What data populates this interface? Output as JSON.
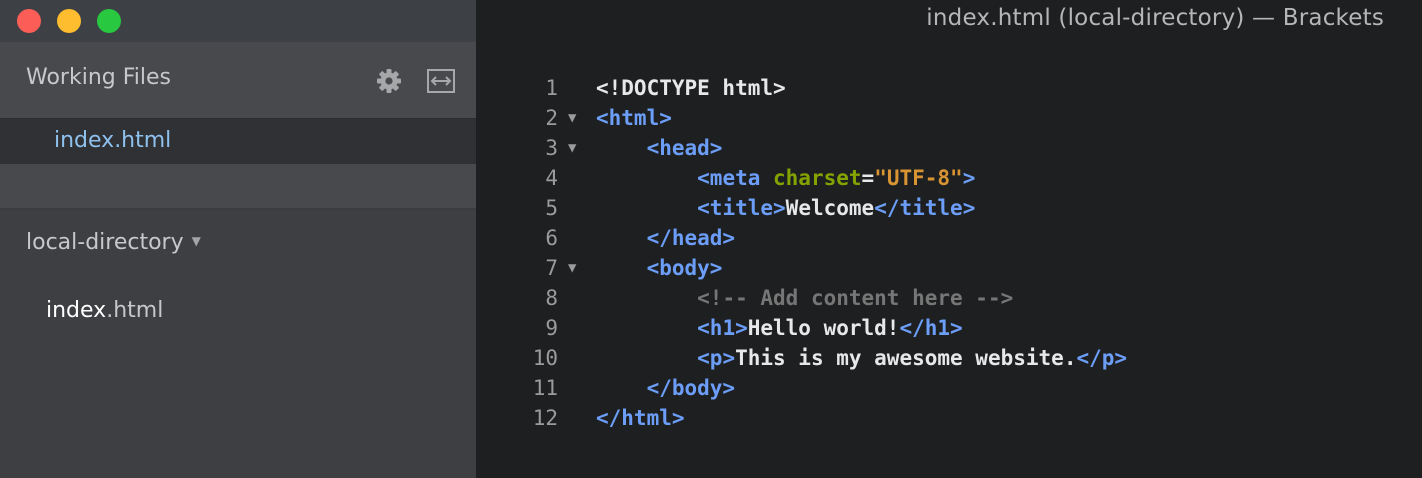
{
  "window": {
    "title": "index.html (local-directory) — Brackets",
    "colors": {
      "close": "#fc5e57",
      "minimize": "#fdbd2e",
      "zoom": "#28c840"
    }
  },
  "sidebar": {
    "working_files_title": "Working Files",
    "settings_icon": "gear-icon",
    "split_icon": "split-view-icon",
    "working_files": [
      {
        "label": "index.html",
        "active": true
      }
    ],
    "project": {
      "title": "local-directory",
      "caret_icon": "caret-down-icon",
      "files": [
        {
          "name": "index",
          "ext": ".html"
        }
      ]
    }
  },
  "editor": {
    "lines": [
      {
        "number": "1",
        "fold": "",
        "tokens": [
          {
            "t": "doct",
            "v": "<!DOCTYPE html>"
          }
        ]
      },
      {
        "number": "2",
        "fold": "▼",
        "tokens": [
          {
            "t": "tag",
            "v": "<html>"
          }
        ]
      },
      {
        "number": "3",
        "fold": "▼",
        "tokens": [
          {
            "t": "txt",
            "v": "    "
          },
          {
            "t": "tag",
            "v": "<head>"
          }
        ]
      },
      {
        "number": "4",
        "fold": "",
        "tokens": [
          {
            "t": "txt",
            "v": "        "
          },
          {
            "t": "tag",
            "v": "<meta "
          },
          {
            "t": "attr",
            "v": "charset"
          },
          {
            "t": "txt",
            "v": "="
          },
          {
            "t": "str",
            "v": "\"UTF-8\""
          },
          {
            "t": "tag",
            "v": ">"
          }
        ]
      },
      {
        "number": "5",
        "fold": "",
        "tokens": [
          {
            "t": "txt",
            "v": "        "
          },
          {
            "t": "tag",
            "v": "<title>"
          },
          {
            "t": "txt",
            "v": "Welcome"
          },
          {
            "t": "tag",
            "v": "</title>"
          }
        ]
      },
      {
        "number": "6",
        "fold": "",
        "tokens": [
          {
            "t": "txt",
            "v": "    "
          },
          {
            "t": "tag",
            "v": "</head>"
          }
        ]
      },
      {
        "number": "7",
        "fold": "▼",
        "tokens": [
          {
            "t": "txt",
            "v": "    "
          },
          {
            "t": "tag",
            "v": "<body>"
          }
        ]
      },
      {
        "number": "8",
        "fold": "",
        "tokens": [
          {
            "t": "txt",
            "v": "        "
          },
          {
            "t": "cmt",
            "v": "<!-- Add content here -->"
          }
        ]
      },
      {
        "number": "9",
        "fold": "",
        "tokens": [
          {
            "t": "txt",
            "v": "        "
          },
          {
            "t": "tag",
            "v": "<h1>"
          },
          {
            "t": "txt",
            "v": "Hello world!"
          },
          {
            "t": "tag",
            "v": "</h1>"
          }
        ]
      },
      {
        "number": "10",
        "fold": "",
        "tokens": [
          {
            "t": "txt",
            "v": "        "
          },
          {
            "t": "tag",
            "v": "<p>"
          },
          {
            "t": "txt",
            "v": "This is my awesome website."
          },
          {
            "t": "tag",
            "v": "</p>"
          }
        ]
      },
      {
        "number": "11",
        "fold": "",
        "tokens": [
          {
            "t": "txt",
            "v": "    "
          },
          {
            "t": "tag",
            "v": "</body>"
          }
        ]
      },
      {
        "number": "12",
        "fold": "",
        "tokens": [
          {
            "t": "tag",
            "v": "</html>"
          }
        ]
      }
    ]
  }
}
